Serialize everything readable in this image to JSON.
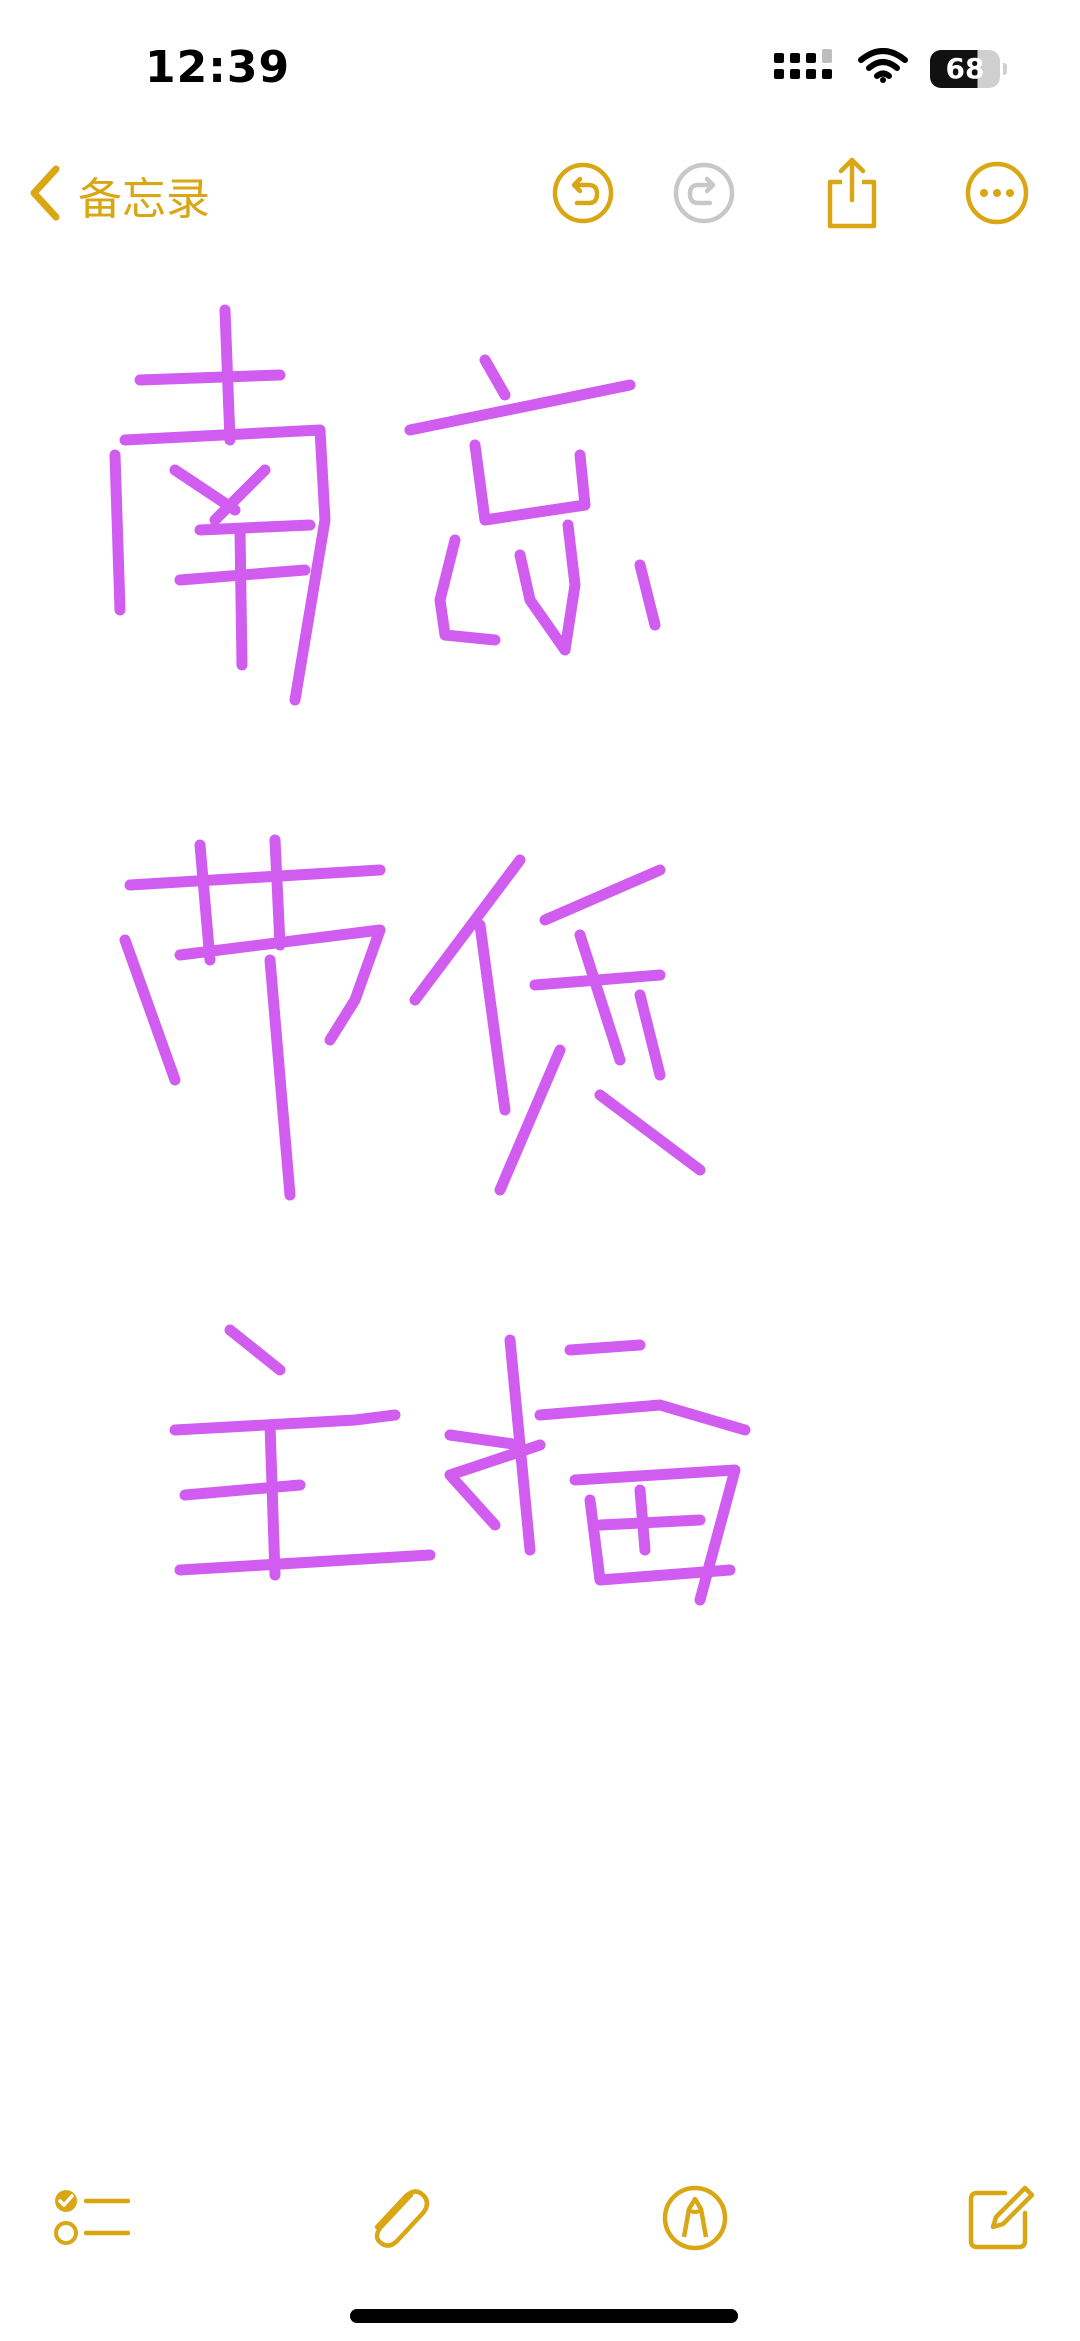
{
  "status_bar": {
    "time": "12:39",
    "battery_level": "68",
    "signal_icon": "cellular-signal-icon",
    "wifi_icon": "wifi-icon"
  },
  "nav": {
    "back_label": "备忘录",
    "back_icon": "chevron-left-icon",
    "undo_icon": "undo-icon",
    "redo_icon": "redo-icon",
    "redo_enabled": false,
    "share_icon": "share-icon",
    "more_icon": "ellipsis-circle-icon"
  },
  "note": {
    "content_type": "handwritten-drawing",
    "ink_color": "#D05CF0",
    "lines": [
      "南京",
      "带货",
      "主播"
    ]
  },
  "toolbar": {
    "checklist_icon": "checklist-icon",
    "attachment_icon": "paperclip-icon",
    "markup_icon": "markup-pen-icon",
    "compose_icon": "compose-icon"
  },
  "colors": {
    "accent": "#D9A714",
    "disabled": "#C8C8C8",
    "ink": "#D05CF0"
  }
}
